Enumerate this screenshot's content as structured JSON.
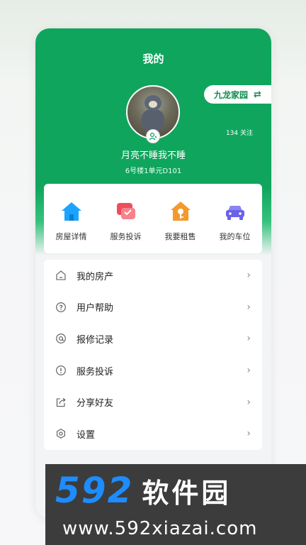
{
  "header": {
    "title": "我的",
    "community": "九龙家园",
    "follow": "134 关注"
  },
  "profile": {
    "name": "月亮不睡我不睡",
    "address": "6号楼1单元D101"
  },
  "quick_actions": [
    {
      "label": "房屋详情",
      "icon": "house-icon"
    },
    {
      "label": "服务投诉",
      "icon": "complaint-icon"
    },
    {
      "label": "我要租售",
      "icon": "rent-key-icon"
    },
    {
      "label": "我的车位",
      "icon": "car-icon"
    }
  ],
  "menu": [
    {
      "label": "我的房产",
      "icon": "home-outline-icon"
    },
    {
      "label": "用户帮助",
      "icon": "help-icon"
    },
    {
      "label": "报修记录",
      "icon": "repair-icon"
    },
    {
      "label": "服务投诉",
      "icon": "alert-icon"
    },
    {
      "label": "分享好友",
      "icon": "share-icon"
    },
    {
      "label": "设置",
      "icon": "settings-icon"
    }
  ],
  "colors": {
    "brand_green": "#0fa55d",
    "house_blue": "#1aa3ff",
    "complaint_red": "#ef4d5a",
    "key_orange": "#f39a2b",
    "car_purple": "#6a62e8"
  },
  "watermark": {
    "digits": "592",
    "brand": "软件园",
    "url": "www.592xiazai.com"
  }
}
